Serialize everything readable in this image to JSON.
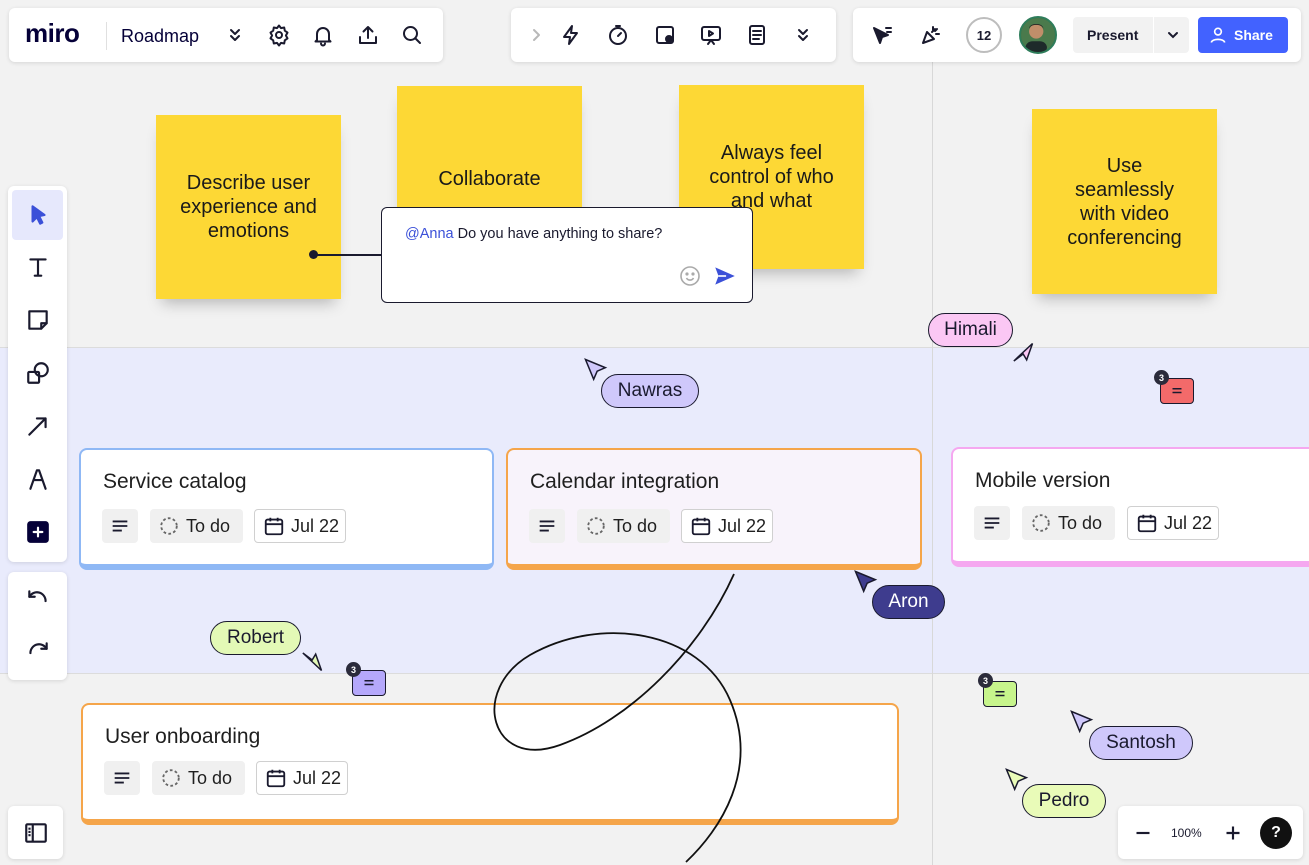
{
  "app": {
    "logo": "miro",
    "board_name": "Roadmap"
  },
  "header": {
    "collaborator_count": "12",
    "present_label": "Present",
    "share_label": "Share"
  },
  "stickies": [
    {
      "text": "Describe user experience and emotions"
    },
    {
      "text": "Collaborate"
    },
    {
      "text": "Always feel control of who and what"
    },
    {
      "text": "Use seamlessly with video conferencing"
    }
  ],
  "comment": {
    "mention": "@Anna",
    "text": " Do you have anything to share?"
  },
  "cards": [
    {
      "title": "Service catalog",
      "status": "To do",
      "date": "Jul 22",
      "color": "#8fb8f5"
    },
    {
      "title": "Calendar integration",
      "status": "To do",
      "date": "Jul 22",
      "color": "#f5a54a"
    },
    {
      "title": "Mobile version",
      "status": "To do",
      "date": "Jul 22",
      "color": "#f5a8f0"
    },
    {
      "title": "User onboarding",
      "status": "To do",
      "date": "Jul 22",
      "color": "#f5a54a"
    }
  ],
  "cursors": [
    {
      "name": "Himali",
      "color": "#fbc7f4"
    },
    {
      "name": "Nawras",
      "color": "#cfc8fb"
    },
    {
      "name": "Aron",
      "color": "#3e3c8e"
    },
    {
      "name": "Robert",
      "color": "#e3f9b6"
    },
    {
      "name": "Santosh",
      "color": "#cfc8fb"
    },
    {
      "name": "Pedro",
      "color": "#e9fbb8"
    }
  ],
  "comment_badges": [
    {
      "count": "3",
      "color": "#f36a6a"
    },
    {
      "count": "3",
      "color": "#b5a8fb"
    },
    {
      "count": "3",
      "color": "#c7f58c"
    }
  ],
  "zoom": {
    "level": "100%"
  },
  "help": {
    "label": "?"
  }
}
